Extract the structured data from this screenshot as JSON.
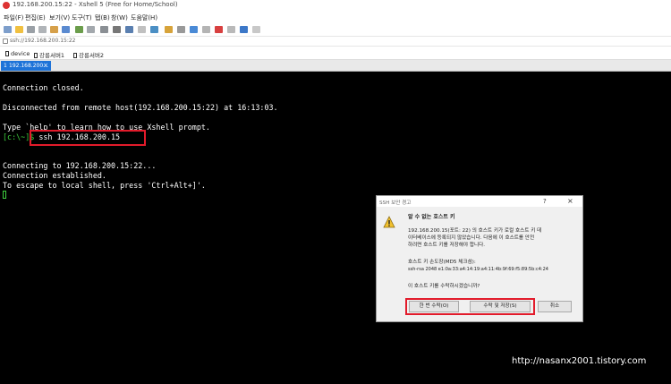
{
  "window": {
    "title": "192.168.200.15:22 - Xshell 5 (Free for Home/School)"
  },
  "menu": {
    "items": [
      "파일(F)",
      "편집(E)",
      "보기(V)",
      "도구(T)",
      "탭(B)",
      "창(W)",
      "도움말(H)"
    ]
  },
  "address": {
    "value": "ssh://192.168.200.15:22"
  },
  "links": {
    "items": [
      "device",
      "강릉서버1",
      "강릉서버2"
    ]
  },
  "tab": {
    "number": "1",
    "label": "192.168.200...",
    "close": "×"
  },
  "terminal": {
    "lines": [
      "Connection closed.",
      "",
      "Disconnected from remote host(192.168.200.15:22) at 16:13:03.",
      "",
      "Type `help' to learn how to use Xshell prompt.",
      "",
      "",
      "",
      "Connecting to 192.168.200.15:22...",
      "Connection established.",
      "To escape to local shell, press 'Ctrl+Alt+]'."
    ],
    "prompt": "[c:\\~]$",
    "command": " ssh 192.168.200.15"
  },
  "dialog": {
    "title": "SSH 보안 경고",
    "help": "?",
    "close": "×",
    "heading": "알 수 없는 호스트 키",
    "message": "192.168.200.15(포트: 22) 의 호스트 키가 로컬 호스트 키 데\n이터베이스에 등록되지 않았습니다. 다음에 이 호스트를 안전\n하려면 호스트 키를 저장해야 합니다.",
    "fingerprint_label": "호스트 키 손도장(MD5 체크섬):",
    "fingerprint": "ssh-rsa 2048 e1:0a:33:a4:14:19:a4:11:4b:9f:69:f5:89:5b:c4:24",
    "question": "이 호스트 키를 수락하시겠습니까?",
    "buttons": [
      "한 번 수락(O)",
      "수락 및 저장(S)",
      "취소"
    ]
  },
  "watermark": "http://nasanx2001.tistory.com",
  "colors": {
    "terminal_bg": "#000000",
    "prompt": "#3ecf3e",
    "highlight": "#e21b2b",
    "tab_active": "#1e73d8"
  }
}
